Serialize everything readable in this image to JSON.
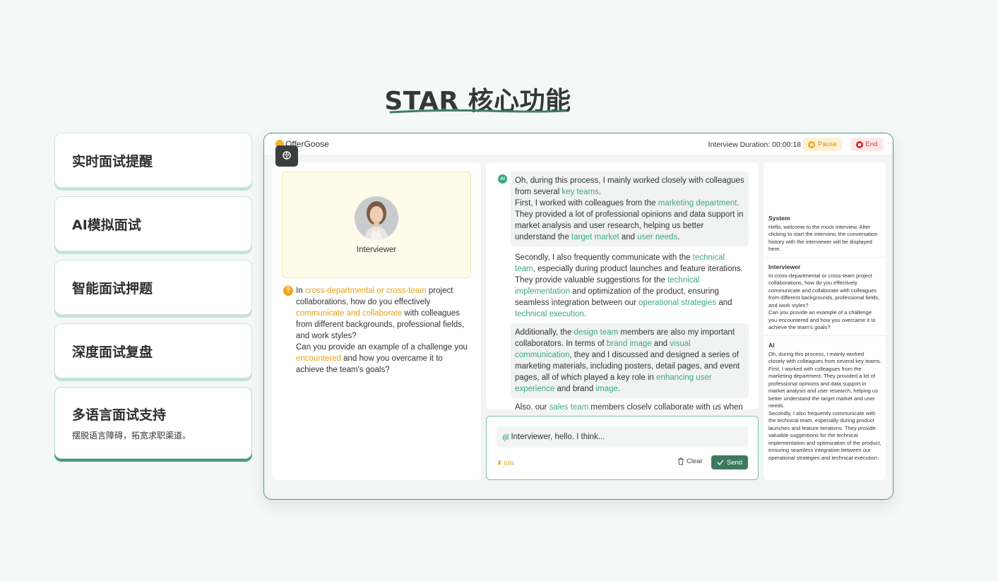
{
  "page": {
    "title": "STAR 核心功能"
  },
  "features": [
    {
      "title": "实时面试提醒",
      "desc": ""
    },
    {
      "title": "AI模拟面试",
      "desc": ""
    },
    {
      "title": "智能面试押题",
      "desc": ""
    },
    {
      "title": "深度面试复盘",
      "desc": ""
    },
    {
      "title": "多语言面试支持",
      "desc": "摆脱语言障碍，拓宽求职渠道。"
    }
  ],
  "app": {
    "logo": "OfferGoose",
    "duration_label": "Interview Duration: 00:00:18",
    "pause_label": "Pause",
    "end_label": "End",
    "interviewer_label": "Interviewer",
    "question": {
      "p1": "In ",
      "h1": "cross-departmental or cross-team",
      "p2": " project collaborations, how do you effectively ",
      "h2": "communicate and collaborate",
      "p3": " with colleagues from different backgrounds, professional fields, and work styles?",
      "p4": "Can you provide an example of a challenge you ",
      "h3": "encountered",
      "p5": " and how you overcame it to achieve the team's goals?"
    },
    "answer": {
      "m1": {
        "a": "Oh, during this process, I mainly worked closely with colleagues from several ",
        "h1": "key teams",
        "b": ".",
        "c": "First, I worked with colleagues from the ",
        "h2": "marketing department",
        "d": ". They provided a lot of professional opinions and data support in market analysis and user research, helping us better understand the ",
        "h3": "target market",
        "e": " and ",
        "h4": "user needs",
        "f": "."
      },
      "m2": {
        "a": "Secondly, I also frequently communicate with the ",
        "h1": "technical team",
        "b": ", especially during product launches and feature iterations. They provide valuable suggestions for the ",
        "h2": "technical implementation",
        "c": " and optimization of the product, ensuring seamless integration between our ",
        "h3": "operational strategies",
        "d": " and ",
        "h4": "technical execution",
        "e": "."
      },
      "m3": {
        "a": "Additionally, the ",
        "h1": "design team",
        "b": " members are also my important collaborators. In terms of ",
        "h2": "brand image",
        "c": " and ",
        "h3": "visual communication",
        "d": ", they and I discussed and designed a series of marketing materials, including posters, detail pages, and event pages, all of which played a key role in ",
        "h4": "enhancing user experience",
        "e": " and brand ",
        "h5": "image",
        "f": "."
      },
      "m4": {
        "a": "Also, our ",
        "h1": "sales team",
        "b": " members closely collaborate with us when"
      }
    },
    "input_text": "Interviewer, hello. I think...",
    "timer": "69s",
    "clear_label": "Clear",
    "send_label": "Send",
    "history": [
      {
        "title": "System",
        "text": "Hello, welcome to the mock interview. After clicking to start the interview, the conversation history with the interviewer will be displayed here."
      },
      {
        "title": "Interviewer",
        "text": "In cross-departmental or cross-team project collaborations, how do you effectively communicate and collaborate with colleagues from different backgrounds, professional fields, and work styles?\nCan you provide an example of a challenge you encountered and how you overcame it to achieve the team's goals?"
      },
      {
        "title": "AI",
        "text": "Oh, during this process, I mainly worked closely with colleagues from several key teams.\nFirst, I worked with colleagues from the marketing department. They provided a lot of professional opinions and data support in market analysis and user research, helping us better understand the target market and user needs.\nSecondly, I also frequently communicate with the technical team, especially during product launches and feature iterations. They provide valuable suggestions for the technical implementation and optimization of the product, ensuring seamless integration between our operational strategies and technical execution."
      }
    ]
  }
}
